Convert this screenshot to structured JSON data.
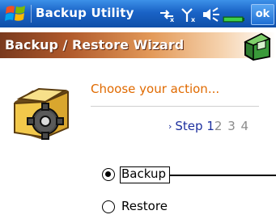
{
  "taskbar": {
    "app_title": "Backup Utility",
    "icons": [
      "start-flag-icon",
      "connectivity-icon",
      "signal-icon",
      "speaker-icon",
      "battery-icon"
    ],
    "ok_label": "ok"
  },
  "wizard": {
    "title": "Backup / Restore Wizard",
    "header_icon": "backup-disk-icon"
  },
  "main": {
    "action_icon": "folder-gear-icon",
    "prompt": "Choose your action...",
    "step_label": "Step",
    "step_current": "1",
    "step_future": "2 3 4",
    "options": [
      {
        "label": "Backup",
        "selected": true
      },
      {
        "label": "Restore",
        "selected": false
      }
    ]
  },
  "colors": {
    "taskbar": "#1a63c6",
    "wizard_bar_dark": "#7a3a1e",
    "prompt": "#e06a00",
    "step_text": "#1c2f9e",
    "step_future": "#8c8c8c"
  }
}
